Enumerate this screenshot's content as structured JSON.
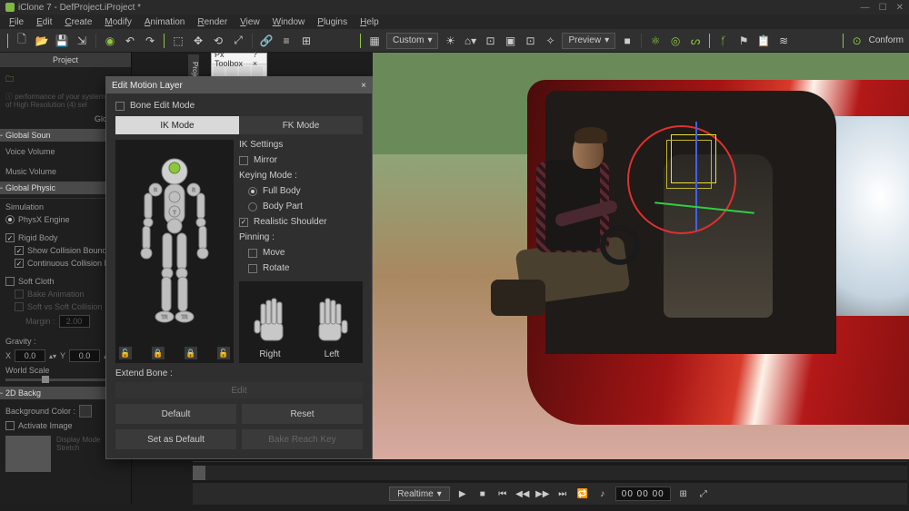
{
  "app": {
    "title": "iClone 7 - DefProject.iProject *"
  },
  "window_controls": {
    "min": "—",
    "max": "☐",
    "close": "✕"
  },
  "menu": [
    "File",
    "Edit",
    "Create",
    "Modify",
    "Animation",
    "Render",
    "View",
    "Window",
    "Plugins",
    "Help"
  ],
  "toolbar": {
    "custom_label": "Custom",
    "preview_label": "Preview",
    "conform_label": "Conform"
  },
  "sidebar": {
    "header": "Project",
    "glow": "Glow Se",
    "global_sound": "Global Soun",
    "voice_vol": "Voice Volume",
    "music_vol": "Music Volume",
    "global_phys": "Global Physic",
    "simulation": "Simulation",
    "physx": "PhysX Engine",
    "rigid": "Rigid Body",
    "show_coll": "Show Collision Boundin",
    "cont_coll": "Continuous Collision D",
    "soft": "Soft Cloth",
    "bake_anim": "Bake Animation",
    "soft_vs": "Soft vs Soft Collision",
    "margin": "Margin :",
    "margin_val": "2.00",
    "gravity": "Gravity :",
    "gx_label": "X",
    "gx": "0.0",
    "gy_label": "Y",
    "gy": "0.0",
    "world_scale": "World Scale",
    "bg2d": "2D Backg",
    "bgcolor": "Background Color :",
    "activate": "Activate Image",
    "display": "Display Mode",
    "stretch": "Stretch"
  },
  "mini": {
    "title": "Px Toolbox",
    "menu": "?",
    "close": "×"
  },
  "side_tab": "Project",
  "dialog": {
    "title": "Edit Motion Layer",
    "close": "×",
    "bone_edit": "Bone Edit Mode",
    "ik_mode": "IK Mode",
    "fk_mode": "FK Mode",
    "ik_settings": "IK Settings",
    "mirror": "Mirror",
    "keying": "Keying Mode :",
    "full_body": "Full Body",
    "body_part": "Body Part",
    "realistic": "Realistic Shoulder",
    "pinning": "Pinning :",
    "move": "Move",
    "rotate": "Rotate",
    "right": "Right",
    "left": "Left",
    "extend": "Extend Bone :",
    "edit": "Edit",
    "default": "Default",
    "reset": "Reset",
    "set_default": "Set as Default",
    "bake": "Bake Reach Key",
    "fig_tr": "TR",
    "fig_r": "R",
    "fig_t": "T"
  },
  "playback": {
    "mode": "Realtime",
    "time": "00 00 00"
  }
}
